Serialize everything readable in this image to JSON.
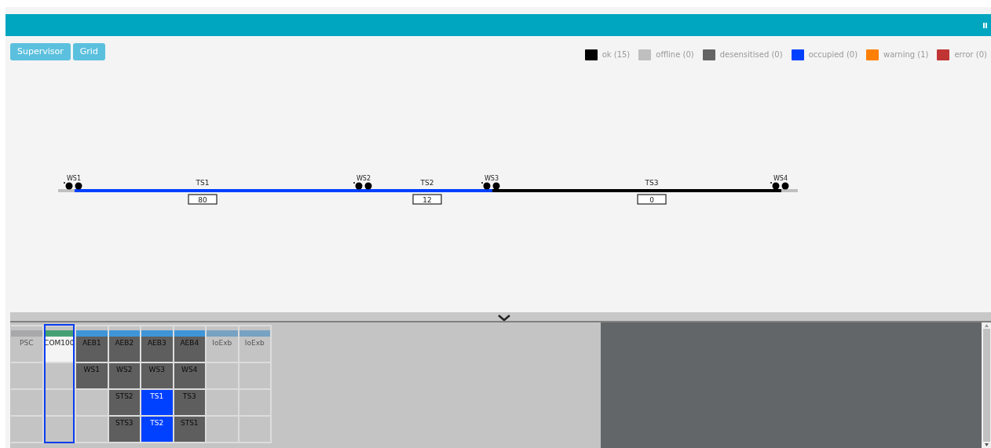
{
  "buttons": [
    {
      "label": "Supervisor"
    },
    {
      "label": "Grid"
    }
  ],
  "legend": [
    {
      "label": "ok (15)",
      "color": "#000000"
    },
    {
      "label": "offline (0)",
      "color": "#bfbfbf"
    },
    {
      "label": "desensitised (0)",
      "color": "#646464"
    },
    {
      "label": "occupied (0)",
      "color": "#0040ff"
    },
    {
      "label": "warning (1)",
      "color": "#ff8000"
    },
    {
      "label": "error (0)",
      "color": "#c03434"
    }
  ],
  "track": {
    "switches": [
      {
        "label": "WS1"
      },
      {
        "label": "WS2"
      },
      {
        "label": "WS3"
      },
      {
        "label": "WS4"
      }
    ],
    "segments": [
      {
        "kind": "stub",
        "color": "#c0c0c0"
      },
      {
        "kind": "section",
        "label": "TS1",
        "value": "80",
        "color": "#0040ff"
      },
      {
        "kind": "section",
        "label": "TS2",
        "value": "12",
        "color": "#0040ff"
      },
      {
        "kind": "section",
        "label": "TS3",
        "value": "0",
        "color": "#000000"
      },
      {
        "kind": "stub",
        "color": "#c0c0c0"
      }
    ]
  },
  "grid": {
    "columns": [
      {
        "color": "#a8a8ab",
        "selected": false
      },
      {
        "color": "#45a074",
        "selected": true
      },
      {
        "color": "#3f95d8",
        "selected": false
      },
      {
        "color": "#3f95d8",
        "selected": false
      },
      {
        "color": "#3f95d8",
        "selected": false
      },
      {
        "color": "#3f95d8",
        "selected": false
      },
      {
        "color": "#77a2c2",
        "selected": false
      },
      {
        "color": "#77a2c2",
        "selected": false
      }
    ],
    "rows": [
      [
        {
          "label": "PSC",
          "kind": "empty"
        },
        {
          "label": "COM100",
          "kind": "active"
        },
        {
          "label": "AEB1",
          "kind": "desensitised"
        },
        {
          "label": "AEB2",
          "kind": "desensitised"
        },
        {
          "label": "AEB3",
          "kind": "desensitised"
        },
        {
          "label": "AEB4",
          "kind": "desensitised"
        },
        {
          "label": "IoExb",
          "kind": "empty"
        },
        {
          "label": "IoExb",
          "kind": "empty"
        }
      ],
      [
        {
          "kind": "empty"
        },
        {
          "kind": "empty"
        },
        {
          "label": "WS1",
          "kind": "desensitised"
        },
        {
          "label": "WS2",
          "kind": "desensitised"
        },
        {
          "label": "WS3",
          "kind": "desensitised"
        },
        {
          "label": "WS4",
          "kind": "desensitised"
        },
        {
          "kind": "empty"
        },
        {
          "kind": "empty"
        }
      ],
      [
        {
          "kind": "empty"
        },
        {
          "kind": "empty"
        },
        {
          "kind": "empty"
        },
        {
          "label": "STS2",
          "kind": "desensitised"
        },
        {
          "label": "TS1",
          "kind": "occupied"
        },
        {
          "label": "TS3",
          "kind": "desensitised"
        },
        {
          "kind": "empty"
        },
        {
          "kind": "empty"
        }
      ],
      [
        {
          "kind": "empty"
        },
        {
          "kind": "empty"
        },
        {
          "kind": "empty"
        },
        {
          "label": "STS3",
          "kind": "desensitised"
        },
        {
          "label": "TS2",
          "kind": "occupied"
        },
        {
          "label": "STS1",
          "kind": "desensitised"
        },
        {
          "kind": "empty"
        },
        {
          "kind": "empty"
        }
      ]
    ]
  }
}
